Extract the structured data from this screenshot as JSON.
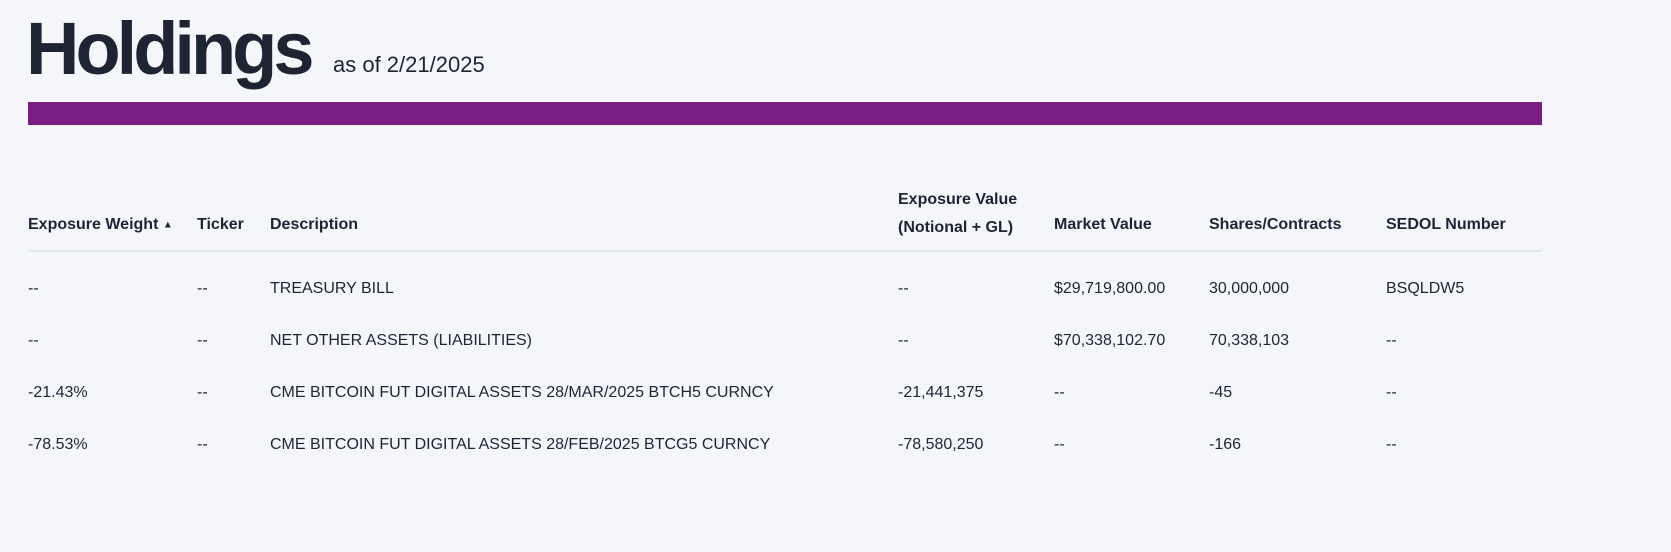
{
  "header": {
    "title": "Holdings",
    "as_of": "as of 2/21/2025"
  },
  "colors": {
    "accent": "#7b1c82",
    "background": "#f5f6fa"
  },
  "table": {
    "columns": [
      "Exposure Weight",
      "Ticker",
      "Description",
      "Exposure Value (Notional + GL)",
      "Market Value",
      "Shares/Contracts",
      "SEDOL Number"
    ],
    "sort_icon": "▲",
    "rows": [
      [
        "--",
        "--",
        "TREASURY BILL",
        "--",
        "$29,719,800.00",
        "30,000,000",
        "BSQLDW5"
      ],
      [
        "--",
        "--",
        "NET OTHER ASSETS (LIABILITIES)",
        "--",
        "$70,338,102.70",
        "70,338,103",
        "--"
      ],
      [
        "-21.43%",
        "--",
        "CME BITCOIN FUT DIGITAL ASSETS 28/MAR/2025 BTCH5 CURNCY",
        "-21,441,375",
        "--",
        "-45",
        "--"
      ],
      [
        "-78.53%",
        "--",
        "CME BITCOIN FUT DIGITAL ASSETS 28/FEB/2025 BTCG5 CURNCY",
        "-78,580,250",
        "--",
        "-166",
        "--"
      ]
    ]
  }
}
